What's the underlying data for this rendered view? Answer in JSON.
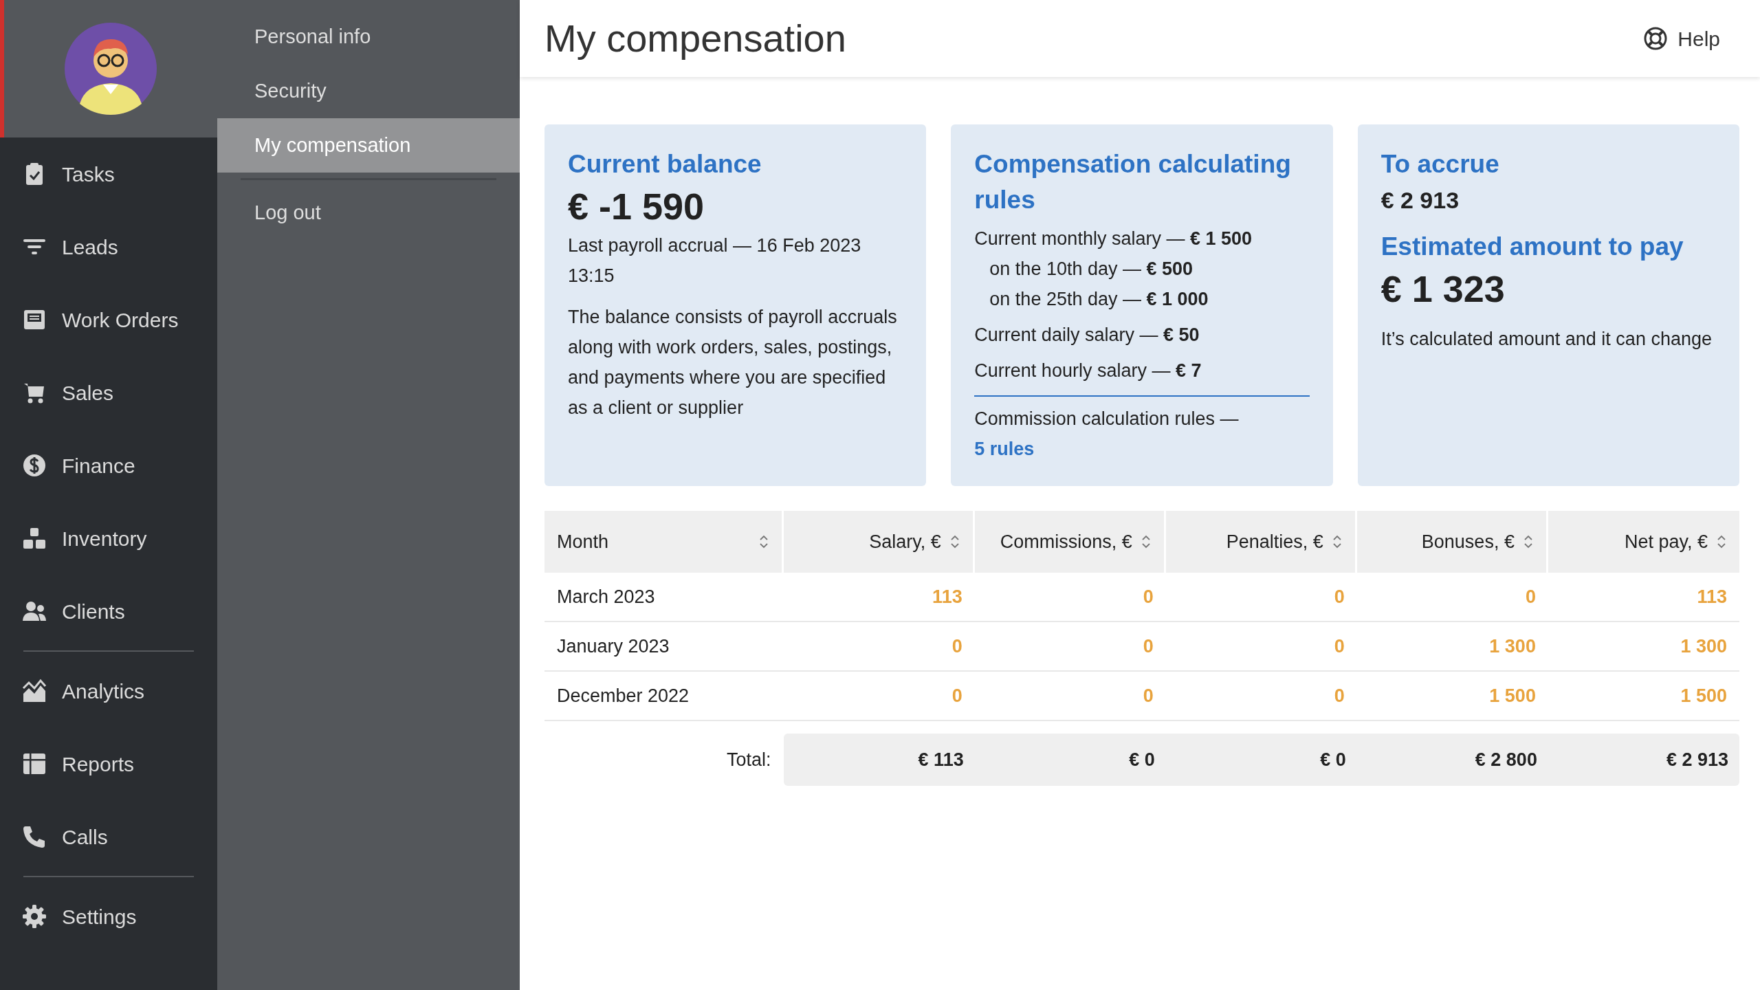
{
  "sidebar": {
    "nav_groups": [
      [
        {
          "label": "Tasks"
        },
        {
          "label": "Leads"
        },
        {
          "label": "Work Orders"
        },
        {
          "label": "Sales"
        },
        {
          "label": "Finance"
        },
        {
          "label": "Inventory"
        },
        {
          "label": "Clients"
        }
      ],
      [
        {
          "label": "Analytics"
        },
        {
          "label": "Reports"
        },
        {
          "label": "Calls"
        }
      ],
      [
        {
          "label": "Settings"
        }
      ]
    ]
  },
  "submenu": {
    "groups": [
      [
        {
          "label": "Personal info",
          "selected": false
        },
        {
          "label": "Security",
          "selected": false
        },
        {
          "label": "My compensation",
          "selected": true
        }
      ],
      [
        {
          "label": "Log out",
          "selected": false
        }
      ]
    ]
  },
  "header": {
    "title": "My compensation",
    "help": "Help"
  },
  "cards": [
    {
      "kind": "balance",
      "title": "Current balance",
      "amount": "€ -1 590",
      "accrual": "Last payroll accrual — 16 Feb 2023 13:15",
      "description": "The balance consists of payroll accruals along with work orders, sales, postings, and payments where you are specified as a client or supplier"
    },
    {
      "kind": "rules",
      "title": "Compensation calculating rules",
      "lines": [
        {
          "kind": "main",
          "text": "Current monthly salary — **€ 1 500**"
        },
        {
          "kind": "sub",
          "text": "on the 10th day — **€ 500**"
        },
        {
          "kind": "sub",
          "text": "on the 25th day — **€ 1 000**"
        },
        {
          "kind": "main",
          "text": "Current daily salary — **€ 50**"
        },
        {
          "kind": "main",
          "text": "Current hourly salary — **€ 7**"
        }
      ],
      "commission_label": "Commission calculation rules —",
      "commission_link": "5 rules"
    },
    {
      "kind": "accrue",
      "title": "To accrue",
      "value": "€ 2 913",
      "estimate_title": "Estimated amount to pay",
      "estimate": "€ 1 323",
      "note": "It’s calculated amount and it can change"
    }
  ],
  "table": {
    "columns": [
      "Month",
      "Salary, €",
      "Commissions, €",
      "Penalties, €",
      "Bonuses, €",
      "Net pay, €"
    ],
    "rows": [
      [
        "March 2023",
        "113",
        "0",
        "0",
        "0",
        "113"
      ],
      [
        "January 2023",
        "0",
        "0",
        "0",
        "1 300",
        "1 300"
      ],
      [
        "December 2022",
        "0",
        "0",
        "0",
        "1 500",
        "1 500"
      ]
    ],
    "total_label": "Total:",
    "totals": [
      "€ 113",
      "€ 0",
      "€ 0",
      "€ 2 800",
      "€ 2 913"
    ]
  }
}
